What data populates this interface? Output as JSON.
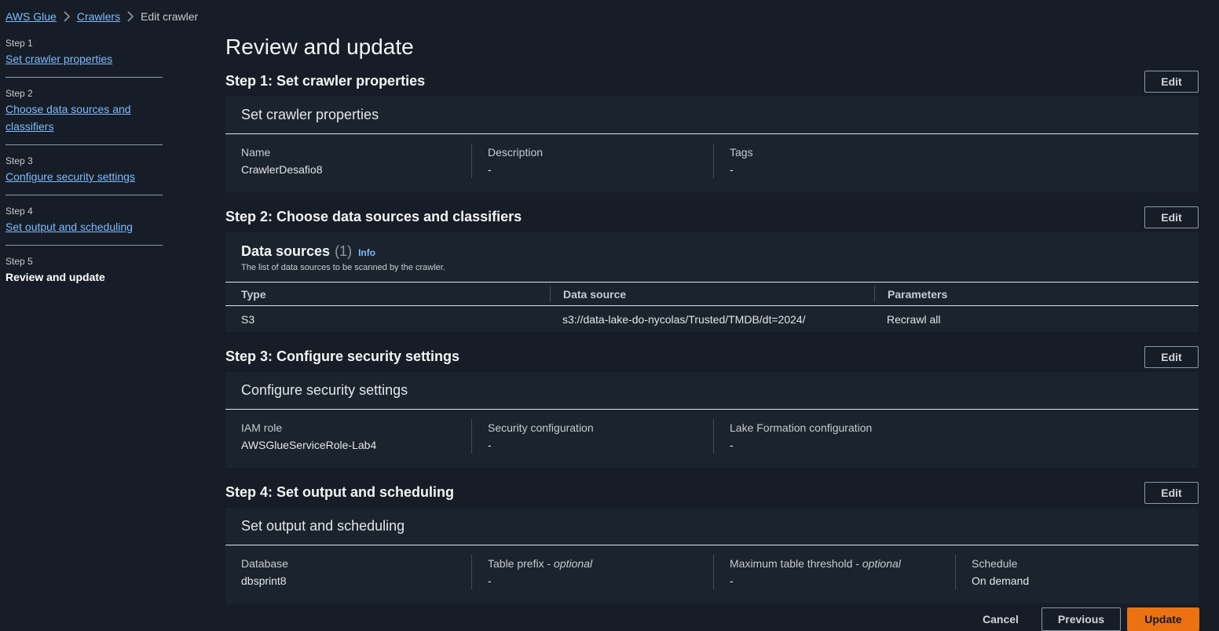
{
  "breadcrumb": {
    "items": [
      {
        "label": "AWS Glue"
      },
      {
        "label": "Crawlers"
      },
      {
        "label": "Edit crawler"
      }
    ]
  },
  "nav": {
    "steps": [
      {
        "number": "Step 1",
        "label": "Set crawler properties"
      },
      {
        "number": "Step 2",
        "label": "Choose data sources and classifiers"
      },
      {
        "number": "Step 3",
        "label": "Configure security settings"
      },
      {
        "number": "Step 4",
        "label": "Set output and scheduling"
      },
      {
        "number": "Step 5",
        "label": "Review and update"
      }
    ]
  },
  "page": {
    "title": "Review and update"
  },
  "step1": {
    "title": "Step 1: Set crawler properties",
    "edit_label": "Edit",
    "card_title": "Set crawler properties",
    "fields": [
      {
        "label": "Name",
        "value": "CrawlerDesafio8"
      },
      {
        "label": "Description",
        "value": "-"
      },
      {
        "label": "Tags",
        "value": "-"
      }
    ]
  },
  "step2": {
    "title": "Step 2: Choose data sources and classifiers",
    "edit_label": "Edit",
    "ds_title": "Data sources",
    "ds_count": "(1)",
    "info_label": "Info",
    "ds_desc": "The list of data sources to be scanned by the crawler.",
    "columns": [
      "Type",
      "Data source",
      "Parameters"
    ],
    "rows": [
      [
        "S3",
        "s3://data-lake-do-nycolas/Trusted/TMDB/dt=2024/",
        "Recrawl all"
      ]
    ]
  },
  "step3": {
    "title": "Step 3: Configure security settings",
    "edit_label": "Edit",
    "card_title": "Configure security settings",
    "fields": [
      {
        "label": "IAM role",
        "value": "AWSGlueServiceRole-Lab4"
      },
      {
        "label": "Security configuration",
        "value": "-"
      },
      {
        "label": "Lake Formation configuration",
        "value": "-"
      }
    ]
  },
  "step4": {
    "title": "Step 4: Set output and scheduling",
    "edit_label": "Edit",
    "card_title": "Set output and scheduling",
    "optional_label": "optional",
    "fields": [
      {
        "label": "Database",
        "value": "dbsprint8"
      },
      {
        "label": "Table prefix",
        "value": "-"
      },
      {
        "label": "Maximum table threshold",
        "value": "-"
      },
      {
        "label": "Schedule",
        "value": "On demand"
      }
    ]
  },
  "footer": {
    "cancel_label": "Cancel",
    "previous_label": "Previous",
    "update_label": "Update"
  },
  "colors": {
    "background": "#161d26",
    "card": "#1b232d",
    "link": "#7fbaff",
    "primary": "#ec7211"
  }
}
